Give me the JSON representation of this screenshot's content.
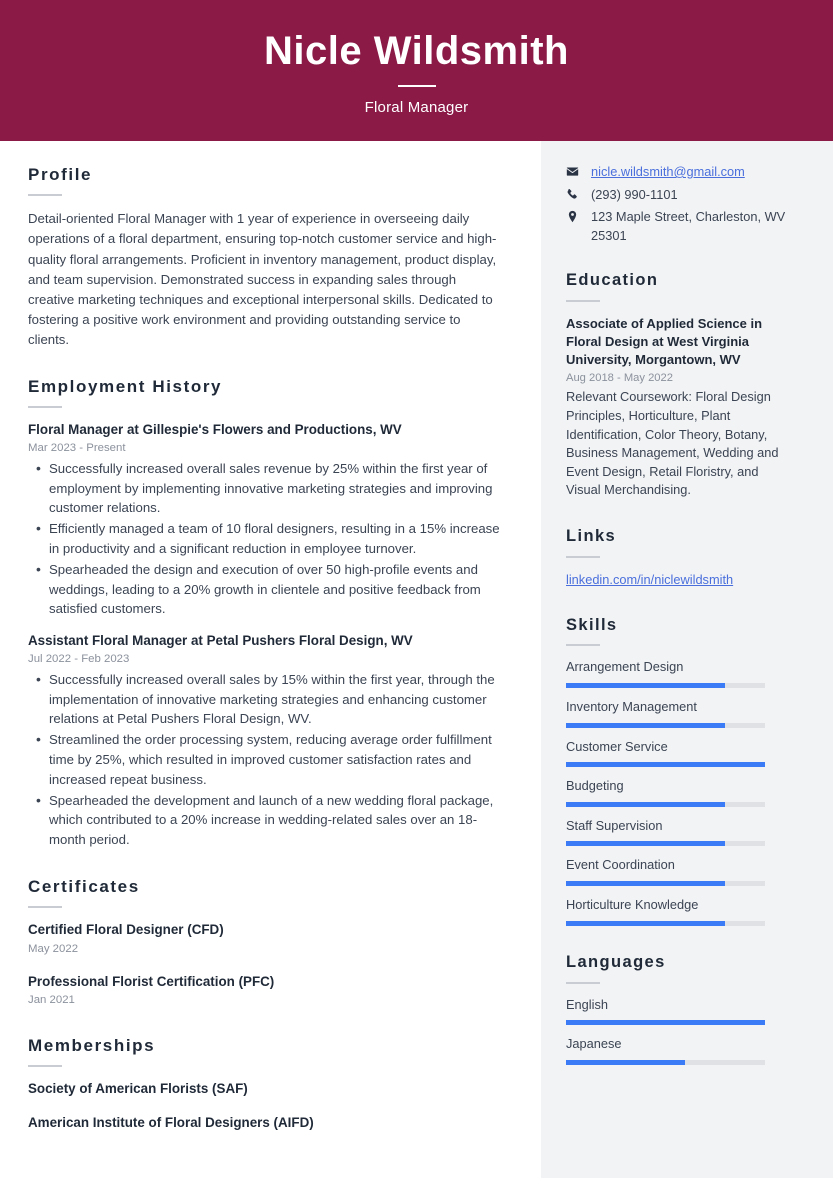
{
  "header": {
    "name": "Nicle Wildsmith",
    "job_title": "Floral Manager",
    "background_color": "#8b1a47"
  },
  "theme": {
    "accent_bar_color": "#3b7cf6",
    "bar_track_color": "#dfe1e5",
    "sidebar_background": "#f2f3f5",
    "link_color": "#4a6fdc",
    "heading_color": "#1f2937"
  },
  "main": {
    "profile": {
      "heading": "Profile",
      "text": "Detail-oriented Floral Manager with 1 year of experience in overseeing daily operations of a floral department, ensuring top-notch customer service and high-quality floral arrangements. Proficient in inventory management, product display, and team supervision. Demonstrated success in expanding sales through creative marketing techniques and exceptional interpersonal skills. Dedicated to fostering a positive work environment and providing outstanding service to clients."
    },
    "employment": {
      "heading": "Employment History",
      "jobs": [
        {
          "title": "Floral Manager at Gillespie's Flowers and Productions, WV",
          "dates": "Mar 2023 - Present",
          "bullets": [
            "Successfully increased overall sales revenue by 25% within the first year of employment by implementing innovative marketing strategies and improving customer relations.",
            "Efficiently managed a team of 10 floral designers, resulting in a 15% increase in productivity and a significant reduction in employee turnover.",
            "Spearheaded the design and execution of over 50 high-profile events and weddings, leading to a 20% growth in clientele and positive feedback from satisfied customers."
          ]
        },
        {
          "title": "Assistant Floral Manager at Petal Pushers Floral Design, WV",
          "dates": "Jul 2022 - Feb 2023",
          "bullets": [
            "Successfully increased overall sales by 15% within the first year, through the implementation of innovative marketing strategies and enhancing customer relations at Petal Pushers Floral Design, WV.",
            "Streamlined the order processing system, reducing average order fulfillment time by 25%, which resulted in improved customer satisfaction rates and increased repeat business.",
            "Spearheaded the development and launch of a new wedding floral package, which contributed to a 20% increase in wedding-related sales over an 18-month period."
          ]
        }
      ]
    },
    "certificates": {
      "heading": "Certificates",
      "items": [
        {
          "title": "Certified Floral Designer (CFD)",
          "date": "May 2022"
        },
        {
          "title": "Professional Florist Certification (PFC)",
          "date": "Jan 2021"
        }
      ]
    },
    "memberships": {
      "heading": "Memberships",
      "items": [
        {
          "title": "Society of American Florists (SAF)"
        },
        {
          "title": "American Institute of Floral Designers (AIFD)"
        }
      ]
    }
  },
  "sidebar": {
    "contact": [
      {
        "icon": "envelope-icon",
        "text": "nicle.wildsmith@gmail.com",
        "is_link": true
      },
      {
        "icon": "phone-icon",
        "text": "(293) 990-1101",
        "is_link": false
      },
      {
        "icon": "location-pin-icon",
        "text": "123 Maple Street, Charleston, WV 25301",
        "is_link": false
      }
    ],
    "education": {
      "heading": "Education",
      "items": [
        {
          "title": "Associate of Applied Science in Floral Design at West Virginia University, Morgantown, WV",
          "dates": "Aug 2018 - May 2022",
          "description": "Relevant Coursework: Floral Design Principles, Horticulture, Plant Identification, Color Theory, Botany, Business Management, Wedding and Event Design, Retail Floristry, and Visual Merchandising."
        }
      ]
    },
    "links": {
      "heading": "Links",
      "items": [
        {
          "text": "linkedin.com/in/niclewildsmith"
        }
      ]
    },
    "skills": {
      "heading": "Skills",
      "items": [
        {
          "label": "Arrangement Design",
          "level": 80
        },
        {
          "label": "Inventory Management",
          "level": 80
        },
        {
          "label": "Customer Service",
          "level": 100
        },
        {
          "label": "Budgeting",
          "level": 80
        },
        {
          "label": "Staff Supervision",
          "level": 80
        },
        {
          "label": "Event Coordination",
          "level": 80
        },
        {
          "label": "Horticulture Knowledge",
          "level": 80
        }
      ]
    },
    "languages": {
      "heading": "Languages",
      "items": [
        {
          "label": "English",
          "level": 100
        },
        {
          "label": "Japanese",
          "level": 60
        }
      ]
    }
  }
}
